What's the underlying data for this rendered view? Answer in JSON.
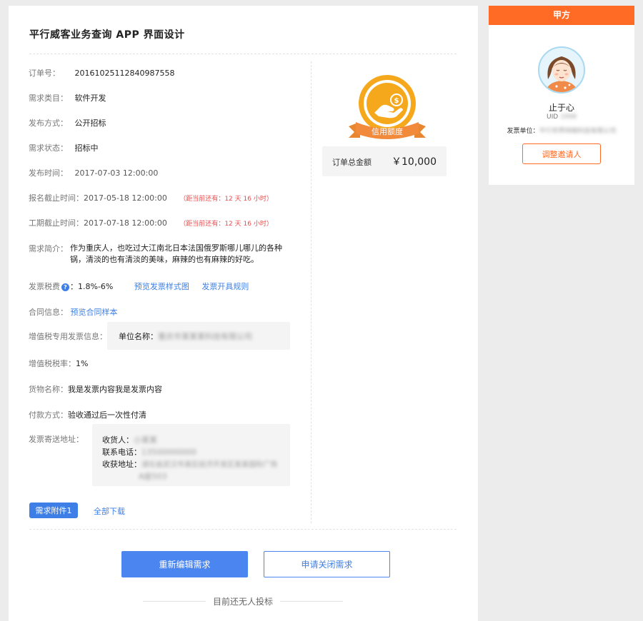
{
  "page_title": "平行威客业务查询 APP 界面设计",
  "details": {
    "order_no": {
      "label": "订单号：",
      "value": "20161025112840987558"
    },
    "category": {
      "label": "需求类目：",
      "value": "软件开发"
    },
    "publish_method": {
      "label": "发布方式：",
      "value": "公开招标"
    },
    "status": {
      "label": "需求状态：",
      "value": "招标中"
    },
    "publish_time": {
      "label": "发布时间：",
      "value": "2017-07-03 12:00:00"
    },
    "signup_deadline": {
      "label": "报名截止时间：",
      "value": "2017-05-18 12:00:00",
      "note": "（距当前还有：12 天 16 小时）"
    },
    "work_deadline": {
      "label": "工期截止时间：",
      "value": "2017-07-18 12:00:00",
      "note": "（距当前还有：12 天 16 小时）"
    },
    "description": {
      "label": "需求简介：",
      "value": "作为重庆人，也吃过大江南北日本法国俄罗斯哪儿哪儿的各种锅，清淡的也有清淡的美味，麻辣的也有麻辣的好吃。"
    },
    "tax": {
      "label": "发票税费",
      "help_icon": "?",
      "value": "：1.8%-6%",
      "preview_link": "预览发票样式图",
      "rules_link": "发票开具规则"
    },
    "contract": {
      "label": "合同信息：",
      "link": "预览合同样本"
    },
    "vat_info": {
      "label": "增值税专用发票信息：",
      "company_label": "单位名称：",
      "company_value": "重庆市某某某科技有限公司"
    },
    "vat_rate": {
      "label": "增值税税率：",
      "value": "1%"
    },
    "goods_name": {
      "label": "货物名称：",
      "value": "我是发票内容我是发票内容"
    },
    "payment": {
      "label": "付款方式：",
      "value": "验收通过后一次性付清"
    },
    "invoice_address": {
      "label": "发票寄送地址：",
      "recipient_label": "收货人：",
      "recipient_value": "小某某",
      "phone_label": "联系电话：",
      "phone_value": "13500000000",
      "address_label": "收获地址：",
      "address_value_1": "湖北省武汉市某区经济开发区某某国际广场",
      "address_value_2": "A座503"
    }
  },
  "attachment": {
    "button": "需求附件1",
    "download_all": "全部下载"
  },
  "badge": {
    "label": "信用额度",
    "icon": "hand-coin-icon"
  },
  "amount": {
    "label": "订单总金额",
    "value": "￥10,000"
  },
  "actions": {
    "re_edit": "重新编辑需求",
    "close": "申请关闭需求"
  },
  "no_bid_text": "目前还无人投标",
  "side": {
    "header": "甲方",
    "user_name": "止于心",
    "uid_label": "UID",
    "uid_value": "1998",
    "company_label": "发票单位：",
    "company_value": "平行世界网络科技有限公司",
    "adjust_button": "调整邀请人"
  },
  "colors": {
    "accent_blue": "#3d7fe6",
    "accent_orange": "#ff6a25",
    "alert_red": "#e94b4b",
    "badge_gold": "#f5a81c"
  }
}
